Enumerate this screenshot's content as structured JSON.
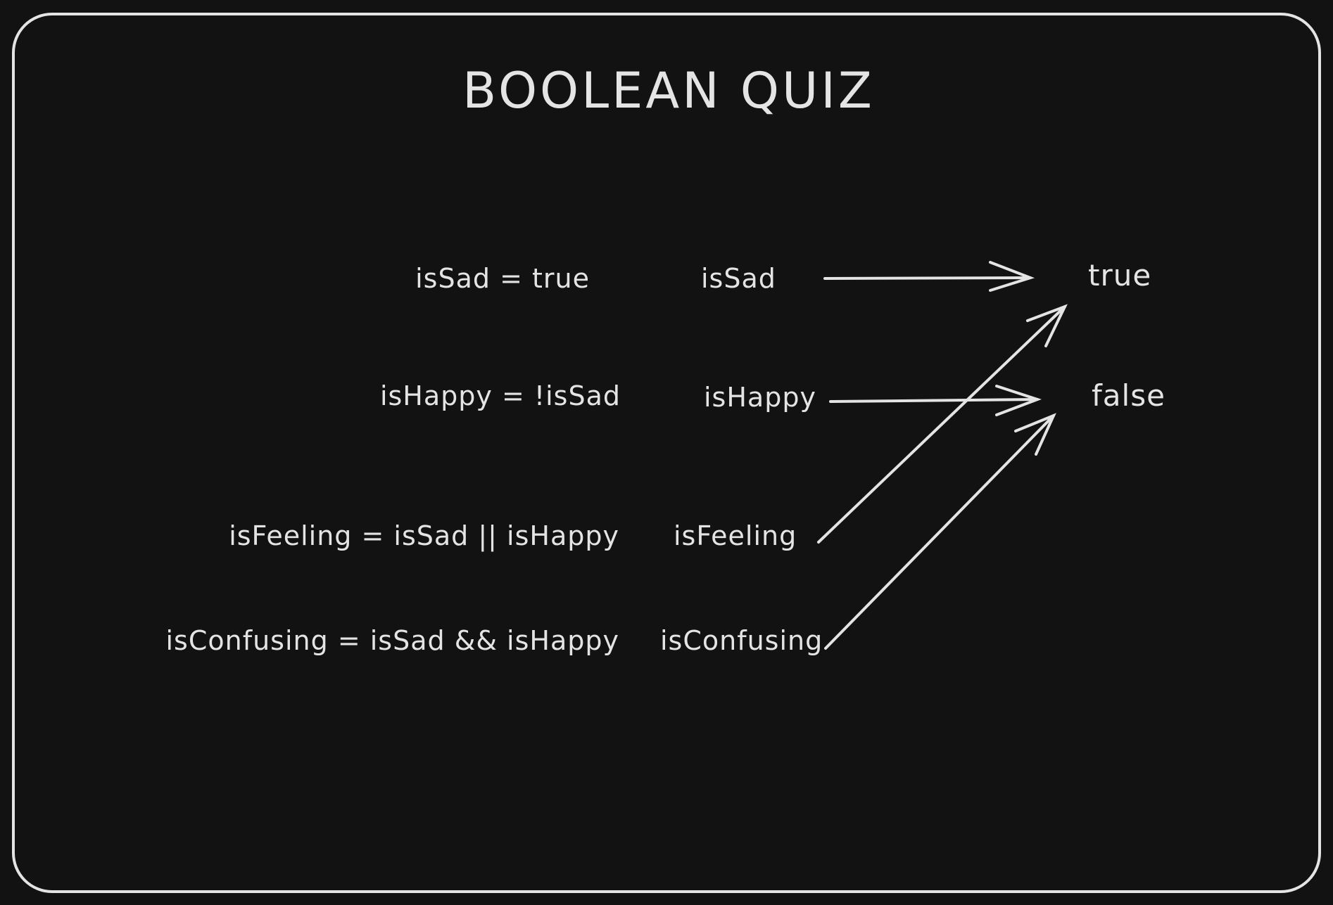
{
  "title": "BOOLEAN QUIZ",
  "expressions": [
    "isSad = true",
    "isHappy = !isSad",
    "isFeeling = isSad || isHappy",
    "isConfusing = isSad && isHappy"
  ],
  "variables": [
    "isSad",
    "isHappy",
    "isFeeling",
    "isConfusing"
  ],
  "values": [
    "true",
    "false"
  ],
  "colors": {
    "background": "#121212",
    "ink": "#e4e4e4"
  }
}
